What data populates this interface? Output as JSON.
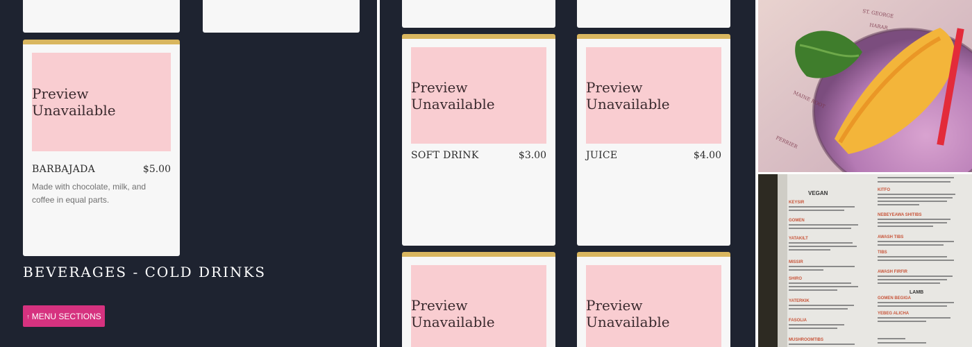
{
  "left": {
    "card": {
      "preview_text": "Preview Unavailable",
      "name": "BARBAJADA",
      "price": "$5.00",
      "description": "Made with chocolate, milk, and coffee in equal parts."
    },
    "section_title": "BEVERAGES - COLD DRINKS",
    "menu_button": {
      "label": "MENU SECTIONS",
      "icon": "up-arrow-icon"
    }
  },
  "middle": {
    "cards": [
      {
        "preview_text": "Preview Unavailable",
        "name": "SOFT DRINK",
        "price": "$3.00"
      },
      {
        "preview_text": "Preview Unavailable",
        "name": "JUICE",
        "price": "$4.00"
      },
      {
        "preview_text": "Preview Unavailable"
      },
      {
        "preview_text": "Preview Unavailable"
      }
    ]
  },
  "right": {
    "top_photo": {
      "menu_lines": [
        "ST. GEORGE",
        "HARAR",
        "MAINE ROOT",
        "PERRIER"
      ]
    },
    "bottom_photo": {
      "headings": [
        "VEGAN",
        "LAMB"
      ],
      "items_left": [
        "KEYSIR",
        "GOMEN",
        "YATAKILT",
        "MISSIR",
        "SHIRO",
        "YATERKIK",
        "FASOLIA",
        "MUSHROOMTIBS"
      ],
      "items_right": [
        "KITFO",
        "NEBEYEAWA SHITIBS",
        "AWASH TIBS",
        "TIBS",
        "AWASH FIRFIR",
        "GOMEN BEGIGA",
        "YEBEG ALICHA"
      ]
    }
  },
  "colors": {
    "background": "#1e2330",
    "card": "#f7f7f7",
    "accent": "#d9b65f",
    "preview": "#f9cdd1",
    "button": "#d6327f"
  }
}
